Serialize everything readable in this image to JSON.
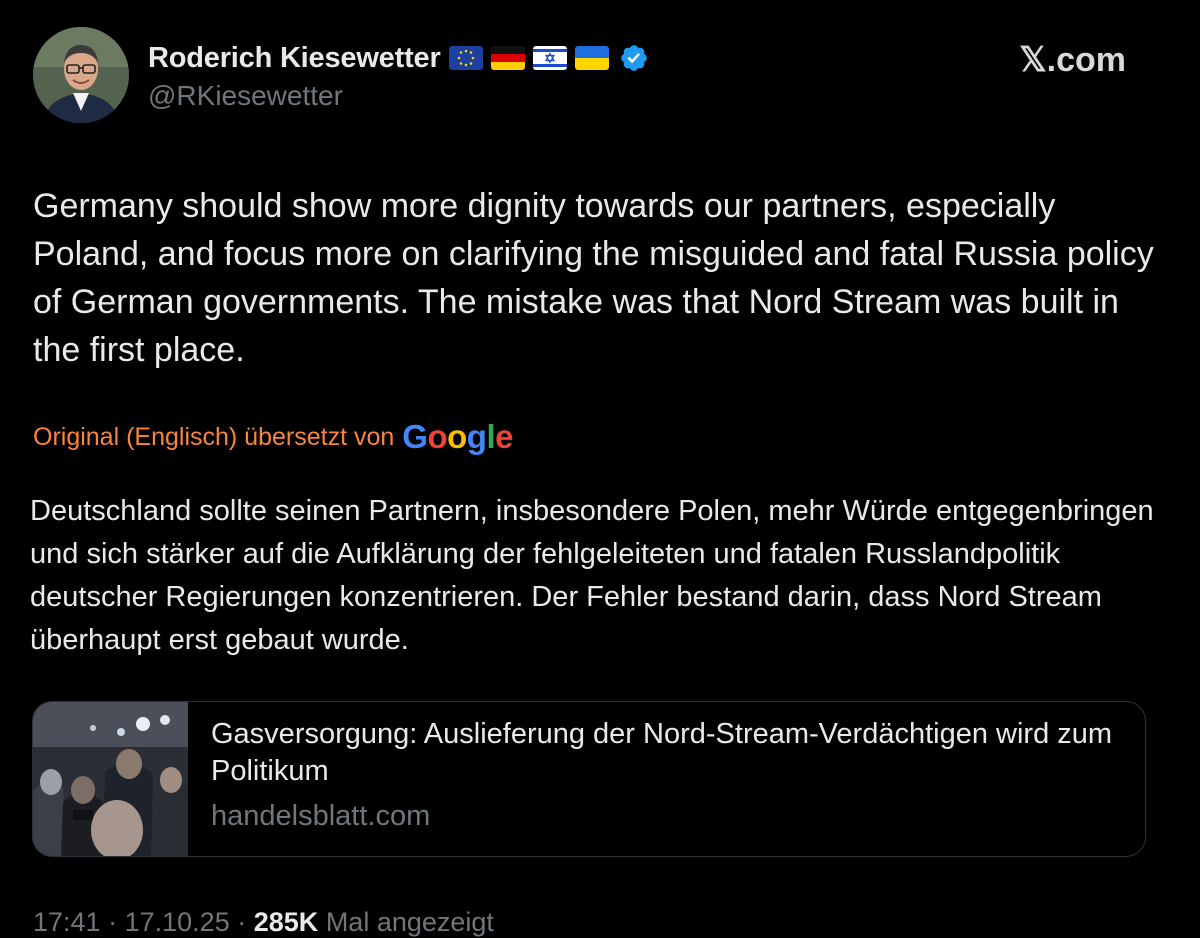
{
  "author": {
    "display_name": "Roderich Kiesewetter",
    "flags": [
      "eu-flag-icon",
      "germany-flag-icon",
      "israel-flag-icon",
      "ukraine-flag-icon"
    ],
    "verified": true,
    "handle": "@RKiesewetter"
  },
  "brand": {
    "watermark": "𝕏.com"
  },
  "tweet": {
    "text": "Germany should show more dignity towards our partners, especially Poland, and focus more on clarifying the misguided and fatal Russia policy of German governments. The mistake was that Nord Stream was built in the first place."
  },
  "translation": {
    "label": "Original (Englisch) übersetzt von",
    "provider": "Google",
    "text": "Deutschland sollte seinen Partnern, insbesondere Polen, mehr Würde entgegenbringen und sich stärker auf die Aufklärung der fehlgeleiteten und fatalen Russlandpolitik deutscher Regierungen konzentrieren. Der Fehler bestand darin, dass Nord Stream überhaupt erst gebaut wurde."
  },
  "link_card": {
    "title": "Gasversorgung: Auslieferung der Nord-Stream-Verdächtigen wird zum Politikum",
    "domain": "handelsblatt.com"
  },
  "meta": {
    "time": "17:41",
    "date": "17.10.25",
    "separator": "·",
    "views": "285K",
    "views_label": "Mal angezeigt"
  },
  "colors": {
    "background": "#000000",
    "text": "#e7e9ea",
    "secondary": "#71767b",
    "translation_accent": "#f7853e",
    "verified": "#1d9bf0"
  }
}
